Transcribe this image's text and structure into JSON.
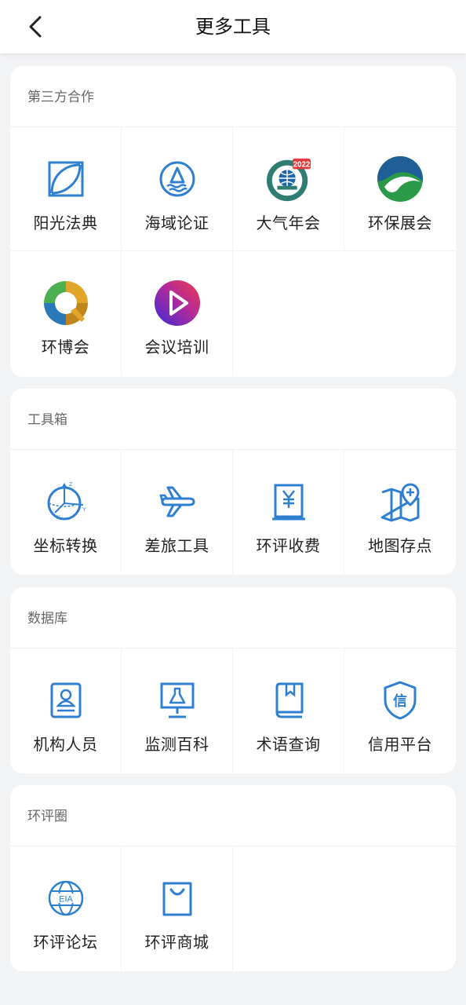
{
  "header": {
    "title": "更多工具"
  },
  "colors": {
    "icon_blue": "#2f7fd0",
    "page_bg": "#f2f3f5"
  },
  "sections": [
    {
      "title": "第三方合作",
      "items": [
        {
          "label": "阳光法典",
          "icon": "law-book-icon"
        },
        {
          "label": "海域论证",
          "icon": "sailboat-icon"
        },
        {
          "label": "大气年会",
          "icon": "cses-emblem-icon",
          "badge": "2022"
        },
        {
          "label": "环保展会",
          "icon": "green-wave-logo-icon"
        },
        {
          "label": "环博会",
          "icon": "ring-logo-icon"
        },
        {
          "label": "会议培训",
          "icon": "play-logo-icon"
        }
      ]
    },
    {
      "title": "工具箱",
      "items": [
        {
          "label": "坐标转换",
          "icon": "coordinate-axes-icon"
        },
        {
          "label": "差旅工具",
          "icon": "airplane-icon"
        },
        {
          "label": "环评收费",
          "icon": "yen-receipt-icon"
        },
        {
          "label": "地图存点",
          "icon": "map-pin-add-icon"
        }
      ]
    },
    {
      "title": "数据库",
      "items": [
        {
          "label": "机构人员",
          "icon": "person-card-icon"
        },
        {
          "label": "监测百科",
          "icon": "monitor-flask-icon"
        },
        {
          "label": "术语查询",
          "icon": "book-bookmark-icon"
        },
        {
          "label": "信用平台",
          "icon": "credit-shield-icon",
          "glyph": "信"
        }
      ]
    },
    {
      "title": "环评圈",
      "items": [
        {
          "label": "环评论坛",
          "icon": "eia-globe-icon",
          "glyph": "EIA"
        },
        {
          "label": "环评商城",
          "icon": "shopping-bag-icon"
        }
      ]
    }
  ]
}
